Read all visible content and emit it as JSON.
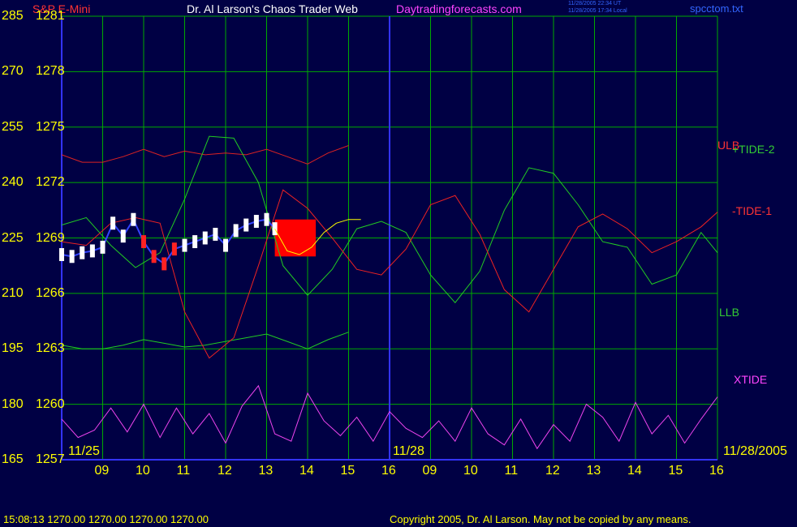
{
  "header": {
    "instrument": "S&P E-Mini",
    "title": "Dr. Al Larson's Chaos Trader Web",
    "site": "Daytradingforecasts.com",
    "timestamp_ut": "11/28/2005 22:34 UT",
    "timestamp_local": "11/28/2005 17:34 Local",
    "file": "spcctom.txt"
  },
  "y_axis": {
    "left_labels": [
      "285",
      "270",
      "255",
      "240",
      "225",
      "210",
      "195",
      "180",
      "165"
    ],
    "price_labels": [
      "1281",
      "1278",
      "1275",
      "1272",
      "1269",
      "1266",
      "1263",
      "1260",
      "1257"
    ]
  },
  "x_axis": {
    "hour_labels": [
      "09",
      "10",
      "11",
      "12",
      "13",
      "14",
      "15",
      "16",
      "09",
      "10",
      "11",
      "12",
      "13",
      "14",
      "15",
      "16"
    ],
    "date_labels": [
      "11/25",
      "11/28",
      "11/28/2005"
    ]
  },
  "series_labels": {
    "ulb": "ULB",
    "tide2": "+TIDE-2",
    "tide1": "-TIDE-1",
    "llb": "LLB",
    "xtide": "XTIDE"
  },
  "footer": {
    "quote": "15:08:13  1270.00 1270.00 1270.00 1270.00",
    "copyright": "Copyright 2005, Dr. Al Larson. May not be copied by any means."
  },
  "colors": {
    "background": "#000044",
    "grid": "#00aa00",
    "ulb": "#dd2222",
    "llb": "#22cc22",
    "tide_red": "#ee2222",
    "tide_green": "#22cc22",
    "xtide": "#ee44ee",
    "price_bars": "#ffffff",
    "forecast_box": "#ff0000",
    "forecast_line": "#ffff00",
    "model_line": "#3344ff",
    "axis": "#3333ff"
  },
  "chart_data": {
    "type": "line",
    "y_range_price": [
      1257,
      1281
    ],
    "y_range_indicator": [
      165,
      285
    ],
    "x_range_hours": [
      8,
      24
    ],
    "grid": true,
    "series": [
      {
        "name": "ULB",
        "x": [
          8,
          8.5,
          9,
          9.5,
          10,
          10.5,
          11,
          11.5,
          12,
          12.5,
          13,
          13.5,
          14,
          14.5,
          15
        ],
        "y": [
          1273.5,
          1273.1,
          1273.1,
          1273.4,
          1273.8,
          1273.4,
          1273.7,
          1273.5,
          1273.6,
          1273.5,
          1273.8,
          1273.4,
          1273.0,
          1273.6,
          1274.0
        ]
      },
      {
        "name": "LLB",
        "x": [
          8,
          8.5,
          9,
          9.5,
          10,
          10.5,
          11,
          11.5,
          12,
          12.5,
          13,
          13.5,
          14,
          14.5,
          15
        ],
        "y": [
          1263.2,
          1263.0,
          1263.0,
          1263.2,
          1263.5,
          1263.3,
          1263.1,
          1263.2,
          1263.4,
          1263.6,
          1263.8,
          1263.4,
          1263.0,
          1263.5,
          1263.9
        ]
      },
      {
        "name": "+TIDE-2",
        "x": [
          8,
          8.6,
          9.2,
          9.8,
          10.4,
          11,
          11.6,
          12.2,
          12.8,
          13.4,
          14,
          14.6,
          15.2,
          15.8,
          16.4,
          17,
          17.6,
          18.2,
          18.8,
          19.4,
          20,
          20.6,
          21.2,
          21.8,
          22.4,
          23,
          23.6,
          24
        ],
        "y": [
          1269.7,
          1270.1,
          1268.6,
          1267.4,
          1268.2,
          1271.1,
          1274.5,
          1274.4,
          1272.0,
          1267.5,
          1265.9,
          1267.3,
          1269.5,
          1269.9,
          1269.3,
          1267.0,
          1265.5,
          1267.2,
          1270.5,
          1272.8,
          1272.5,
          1270.8,
          1268.8,
          1268.5,
          1266.5,
          1267.0,
          1269.3,
          1268.2
        ]
      },
      {
        "name": "-TIDE-1",
        "x": [
          8,
          8.6,
          9.2,
          9.8,
          10.4,
          11,
          11.6,
          12.2,
          12.8,
          13.4,
          14,
          14.6,
          15.2,
          15.8,
          16.4,
          17,
          17.6,
          18.2,
          18.8,
          19.4,
          20,
          20.6,
          21.2,
          21.8,
          22.4,
          23,
          23.6,
          24
        ],
        "y": [
          1268.8,
          1268.6,
          1269.8,
          1270.1,
          1269.8,
          1265.0,
          1262.5,
          1263.6,
          1267.5,
          1271.6,
          1270.6,
          1269.0,
          1267.3,
          1267.0,
          1268.4,
          1270.8,
          1271.3,
          1269.2,
          1266.2,
          1265.0,
          1267.3,
          1269.6,
          1270.3,
          1269.5,
          1268.2,
          1268.8,
          1269.6,
          1270.4
        ]
      },
      {
        "name": "XTIDE",
        "x": [
          8,
          8.4,
          8.8,
          9.2,
          9.6,
          10,
          10.4,
          10.8,
          11.2,
          11.6,
          12,
          12.4,
          12.8,
          13.2,
          13.6,
          14,
          14.4,
          14.8,
          15.2,
          15.6,
          16,
          16.4,
          16.8,
          17.2,
          17.6,
          18,
          18.4,
          18.8,
          19.2,
          19.6,
          20,
          20.4,
          20.8,
          21.2,
          21.6,
          22,
          22.4,
          22.8,
          23.2,
          23.6,
          24
        ],
        "y": [
          1259.2,
          1258.2,
          1258.6,
          1259.8,
          1258.5,
          1260.0,
          1258.2,
          1259.8,
          1258.4,
          1259.5,
          1257.9,
          1259.9,
          1261.0,
          1258.4,
          1258.0,
          1260.6,
          1259.1,
          1258.3,
          1259.3,
          1258.0,
          1259.6,
          1258.7,
          1258.2,
          1259.1,
          1258.0,
          1259.8,
          1258.4,
          1257.8,
          1259.2,
          1257.6,
          1258.9,
          1258.0,
          1260.0,
          1259.3,
          1258.0,
          1260.1,
          1258.4,
          1259.4,
          1257.9,
          1259.2,
          1260.4
        ]
      },
      {
        "name": "Price",
        "x": [
          8,
          8.25,
          8.5,
          8.75,
          9,
          9.25,
          9.5,
          9.75,
          10,
          10.25,
          10.5,
          10.75,
          11,
          11.25,
          11.5,
          11.75,
          12,
          12.25,
          12.5,
          12.75,
          13,
          13.2
        ],
        "y": [
          1268.1,
          1268.0,
          1268.2,
          1268.3,
          1268.5,
          1269.8,
          1269.1,
          1270.0,
          1268.8,
          1268.0,
          1267.6,
          1268.4,
          1268.6,
          1268.8,
          1269.0,
          1269.2,
          1268.6,
          1269.4,
          1269.7,
          1269.9,
          1270.0,
          1269.5
        ]
      },
      {
        "name": "Forecast",
        "x": [
          13.2,
          13.5,
          13.8,
          14.1,
          14.4,
          14.7,
          15,
          15.3
        ],
        "y": [
          1269.5,
          1268.3,
          1268.1,
          1268.5,
          1269.3,
          1269.8,
          1270.0,
          1270.0
        ]
      }
    ],
    "forecast_box": {
      "x_range": [
        13.2,
        14.2
      ],
      "y_range": [
        1268.0,
        1270.0
      ]
    }
  }
}
